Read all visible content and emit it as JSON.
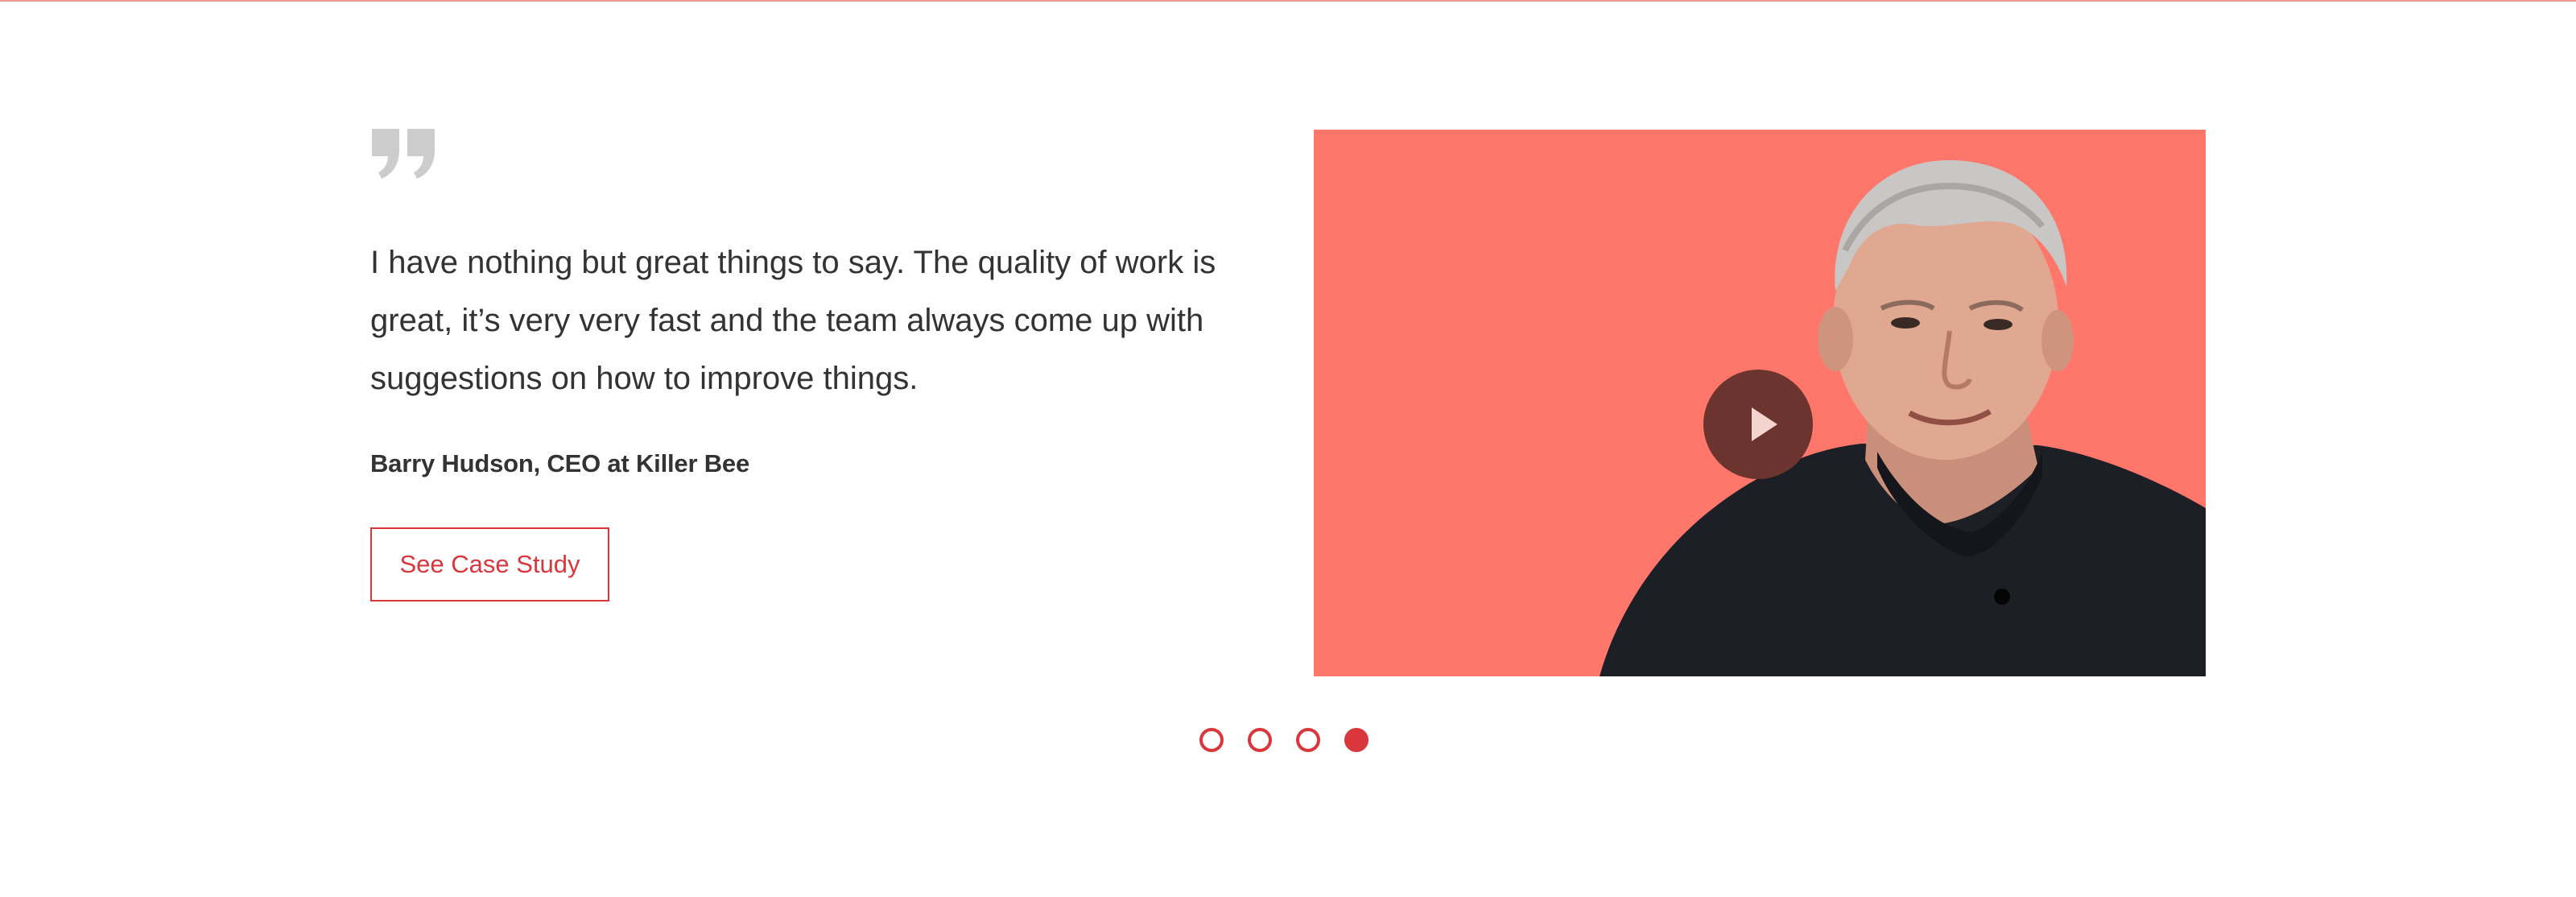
{
  "testimonial": {
    "quote": "I have nothing but great things to say. The quality of work is great, it’s very very fast and the team always come up with suggestions on how to improve things.",
    "author": "Barry Hudson, CEO at Killer Bee",
    "cta_label": "See Case Study",
    "quote_icon": "quote-marks-icon"
  },
  "video": {
    "play_icon": "play-icon",
    "background_color": "#ff766a"
  },
  "carousel": {
    "dots": [
      {
        "active": false
      },
      {
        "active": false
      },
      {
        "active": false
      },
      {
        "active": true
      }
    ],
    "active_index": 3
  },
  "colors": {
    "accent": "#d9373b",
    "text": "#333333",
    "quote_icon": "#cccccc"
  }
}
